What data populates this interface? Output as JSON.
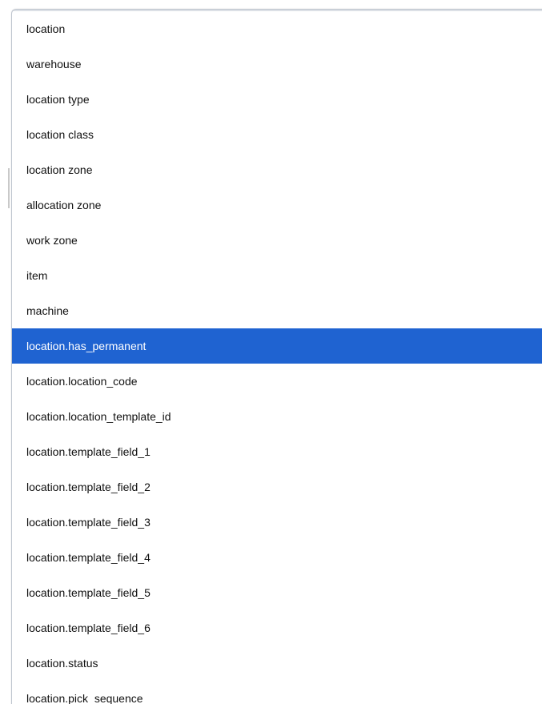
{
  "dropdown": {
    "selected_index": 9,
    "options": [
      "location",
      "warehouse",
      "location type",
      "location class",
      "location zone",
      "allocation zone",
      "work zone",
      "item",
      "machine",
      "location.has_permanent",
      "location.location_code",
      "location.location_template_id",
      "location.template_field_1",
      "location.template_field_2",
      "location.template_field_3",
      "location.template_field_4",
      "location.template_field_5",
      "location.template_field_6",
      "location.status",
      "location.pick_sequence"
    ]
  },
  "colors": {
    "selected_bg": "#1f63d1",
    "selected_text": "#ffffff",
    "text": "#111111"
  }
}
